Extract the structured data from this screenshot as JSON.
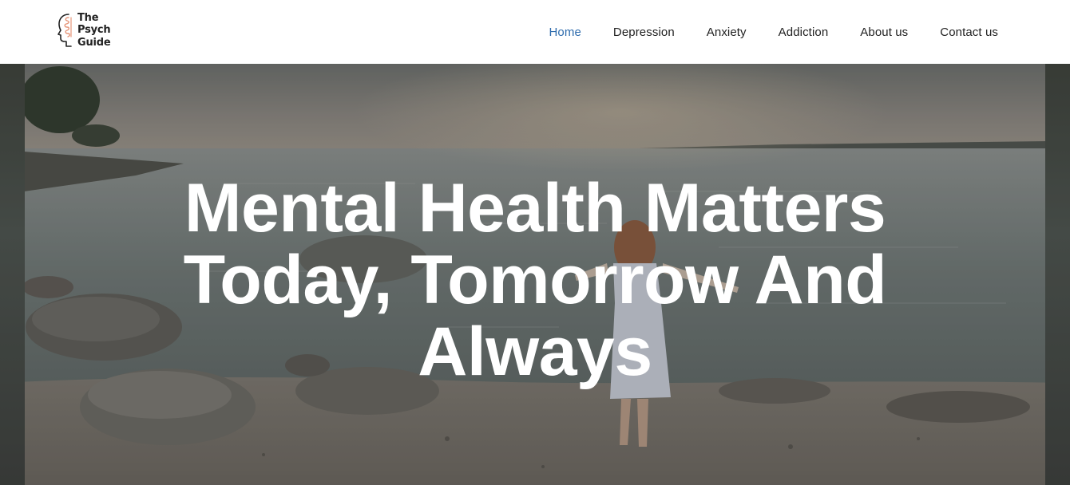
{
  "brand": {
    "logo_lines": [
      "The",
      "Psych",
      "Guide"
    ],
    "logo_icon": "brain-profile-icon",
    "accent_color": "#e6967a"
  },
  "nav": {
    "items": [
      {
        "label": "Home",
        "active": true
      },
      {
        "label": "Depression",
        "active": false
      },
      {
        "label": "Anxiety",
        "active": false
      },
      {
        "label": "Addiction",
        "active": false
      },
      {
        "label": "About us",
        "active": false
      },
      {
        "label": "Contact us",
        "active": false
      }
    ],
    "active_color": "#2e6cad",
    "text_color": "#222222"
  },
  "hero": {
    "title": "Mental Health Matters Today, Tomorrow And Always",
    "title_color": "#ffffff"
  }
}
